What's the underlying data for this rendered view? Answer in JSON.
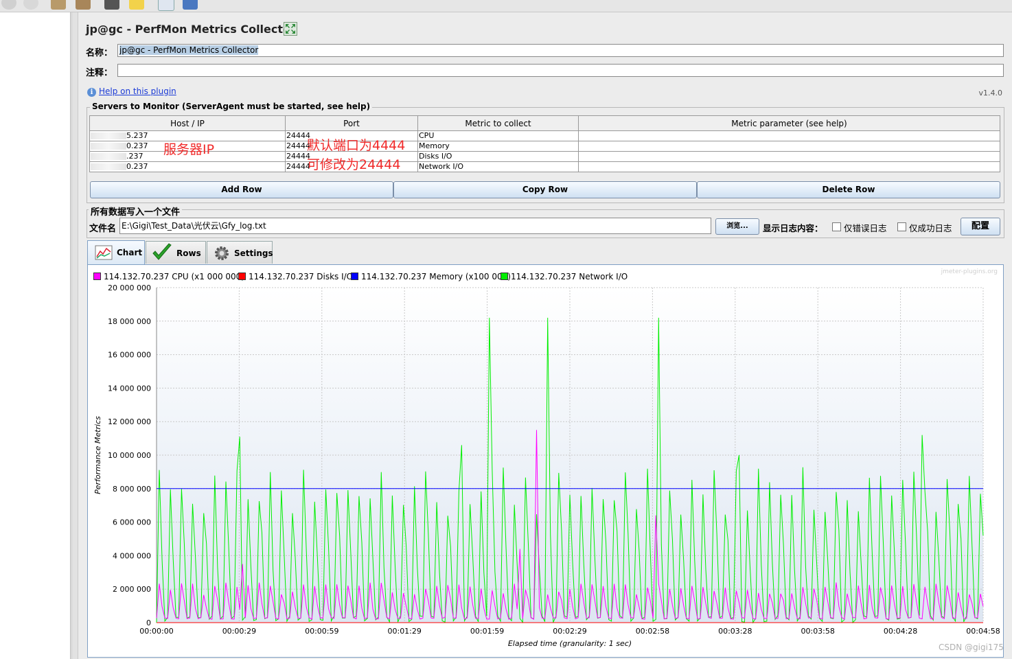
{
  "toolbar_icons": [
    "stop-icon",
    "shutdown-icon",
    "broom-icon",
    "broom-all-icon",
    "binoculars-icon",
    "reset-search-icon",
    "function-helper-icon",
    "help-icon"
  ],
  "window": {
    "title": "jp@gc - PerfMon Metrics Collector",
    "name_label": "名称：",
    "name_value": "jp@gc - PerfMon Metrics Collector",
    "comment_label": "注释：",
    "comment_value": "",
    "help_link": "Help on this plugin",
    "version": "v1.4.0"
  },
  "servers": {
    "legend": "Servers to Monitor (ServerAgent must be started, see help)",
    "columns": [
      "Host / IP",
      "Port",
      "Metric to collect",
      "Metric parameter (see help)"
    ],
    "rows": [
      {
        "host_suffix": "5.237",
        "port": "24444",
        "metric": "CPU",
        "param": ""
      },
      {
        "host_suffix": "0.237",
        "port": "24444",
        "metric": "Memory",
        "param": ""
      },
      {
        "host_suffix": ".237",
        "port": "24444",
        "metric": "Disks I/O",
        "param": ""
      },
      {
        "host_suffix": "0.237",
        "port": "24444",
        "metric": "Network I/O",
        "param": ""
      }
    ],
    "add_row": "Add Row",
    "copy_row": "Copy Row",
    "delete_row": "Delete Row"
  },
  "annotations": {
    "server_ip": "服务器IP",
    "default_port": "默认端口为4444",
    "modify_port": "可修改为24444"
  },
  "file_section": {
    "legend": "所有数据写入一个文件",
    "file_label": "文件名",
    "file_value": "E:\\Gigi\\Test_Data\\光伏云\\Gfy_log.txt",
    "browse": "浏览...",
    "log_content_label": "显示日志内容：",
    "errors_only": "仅错误日志",
    "success_only": "仅成功日志",
    "errors_only_checked": false,
    "success_only_checked": false,
    "configure": "配置"
  },
  "tabs": [
    {
      "label": "Chart",
      "icon": "chart-icon",
      "active": true
    },
    {
      "label": "Rows",
      "icon": "checkmark-icon",
      "active": false
    },
    {
      "label": "Settings",
      "icon": "gear-icon",
      "active": false
    }
  ],
  "chart_watermark": "jmeter-plugins.org",
  "csdn_watermark": "CSDN @gigi175",
  "chart_data": {
    "type": "line",
    "ylabel": "Performance Metrics",
    "xlabel": "Elapsed time (granularity: 1 sec)",
    "ylim": [
      0,
      20000000
    ],
    "y_ticks": [
      "0",
      "2 000 000",
      "4 000 000",
      "6 000 000",
      "8 000 000",
      "10 000 000",
      "12 000 000",
      "14 000 000",
      "16 000 000",
      "18 000 000",
      "20 000 000"
    ],
    "x_ticks": [
      "00:00:00",
      "00:00:29",
      "00:00:59",
      "00:01:29",
      "00:01:59",
      "00:02:29",
      "00:02:58",
      "00:03:28",
      "00:03:58",
      "00:04:28",
      "00:04:58"
    ],
    "xlim_seconds": [
      0,
      298
    ],
    "grid": true,
    "legend_position": "top-left",
    "series": [
      {
        "name": "114.132.70.237 CPU (x1 000 000)",
        "color": "#ff00ff",
        "kind": "cpu",
        "baseline": 200000,
        "typical_peak": 2200000,
        "max": 11500000
      },
      {
        "name": "114.132.70.237 Disks I/O",
        "color": "#ff0000",
        "kind": "flat",
        "value": 0
      },
      {
        "name": "114.132.70.237 Memory (x100 000)",
        "color": "#0000ff",
        "kind": "flat",
        "value": 8000000
      },
      {
        "name": "114.132.70.237 Network I/O",
        "color": "#00ee00",
        "kind": "net",
        "baseline": 0,
        "typical_peak": 8500000,
        "max": 18200000
      }
    ]
  }
}
